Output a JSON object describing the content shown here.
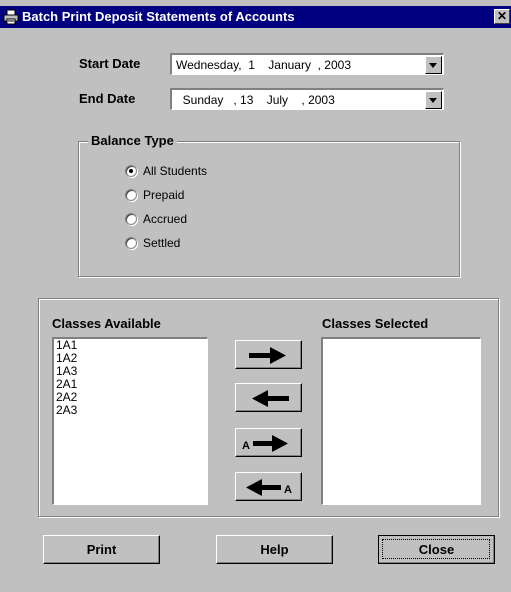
{
  "window": {
    "title": "Batch Print Deposit Statements of Accounts",
    "close_glyph": "✕"
  },
  "dates": {
    "start_label": "Start Date",
    "start_value": "Wednesday,  1    January  , 2003",
    "end_label": "End Date",
    "end_value": "  Sunday   , 13    July    , 2003"
  },
  "balance_type": {
    "label": "Balance Type",
    "options": [
      {
        "label": "All Students",
        "selected": true
      },
      {
        "label": "Prepaid",
        "selected": false
      },
      {
        "label": "Accrued",
        "selected": false
      },
      {
        "label": "Settled",
        "selected": false
      }
    ]
  },
  "classes": {
    "available_label": "Classes Available",
    "selected_label": "Classes Selected",
    "available": [
      "1A1",
      "1A2",
      "1A3",
      "2A1",
      "2A2",
      "2A3"
    ],
    "selected": [],
    "move_all_right_letter": "A",
    "move_all_left_letter": "A"
  },
  "buttons": {
    "print": "Print",
    "help": "Help",
    "close": "Close"
  },
  "icons": {
    "title_icon": "printer-icon",
    "move_right": "arrow-right-icon",
    "move_left": "arrow-left-icon",
    "move_all_right": "arrow-right-all-icon",
    "move_all_left": "arrow-left-all-icon"
  }
}
